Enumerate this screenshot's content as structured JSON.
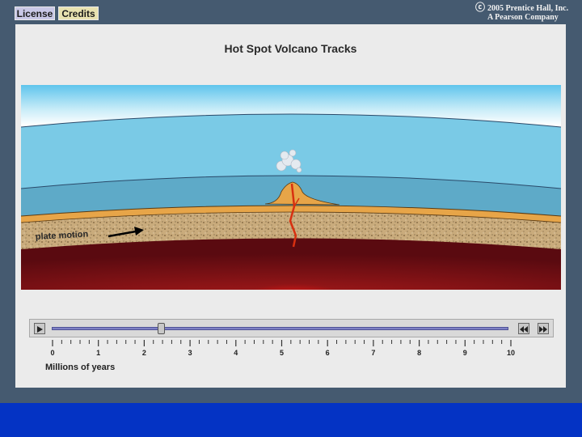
{
  "toolbar": {
    "license_label": "License",
    "credits_label": "Credits"
  },
  "copyright": {
    "symbol": "ⓒ",
    "line1": "2005 Prentice Hall, Inc.",
    "line2": "A Pearson Company"
  },
  "main": {
    "title": "Hot Spot Volcano Tracks",
    "plate_motion_label": "plate motion"
  },
  "timeline": {
    "ticks": [
      "0",
      "1",
      "2",
      "3",
      "4",
      "5",
      "6",
      "7",
      "8",
      "9",
      "10"
    ],
    "axis_label": "Millions of years",
    "position_value": 2.4,
    "play_icon": "play-icon",
    "rewind_icon": "rewind-icon",
    "fast_forward_icon": "fast-forward-icon"
  },
  "colors": {
    "background": "#455a70",
    "panel": "#ebebeb",
    "bottom_bar": "#0433c4",
    "track": "#7e80c4"
  }
}
